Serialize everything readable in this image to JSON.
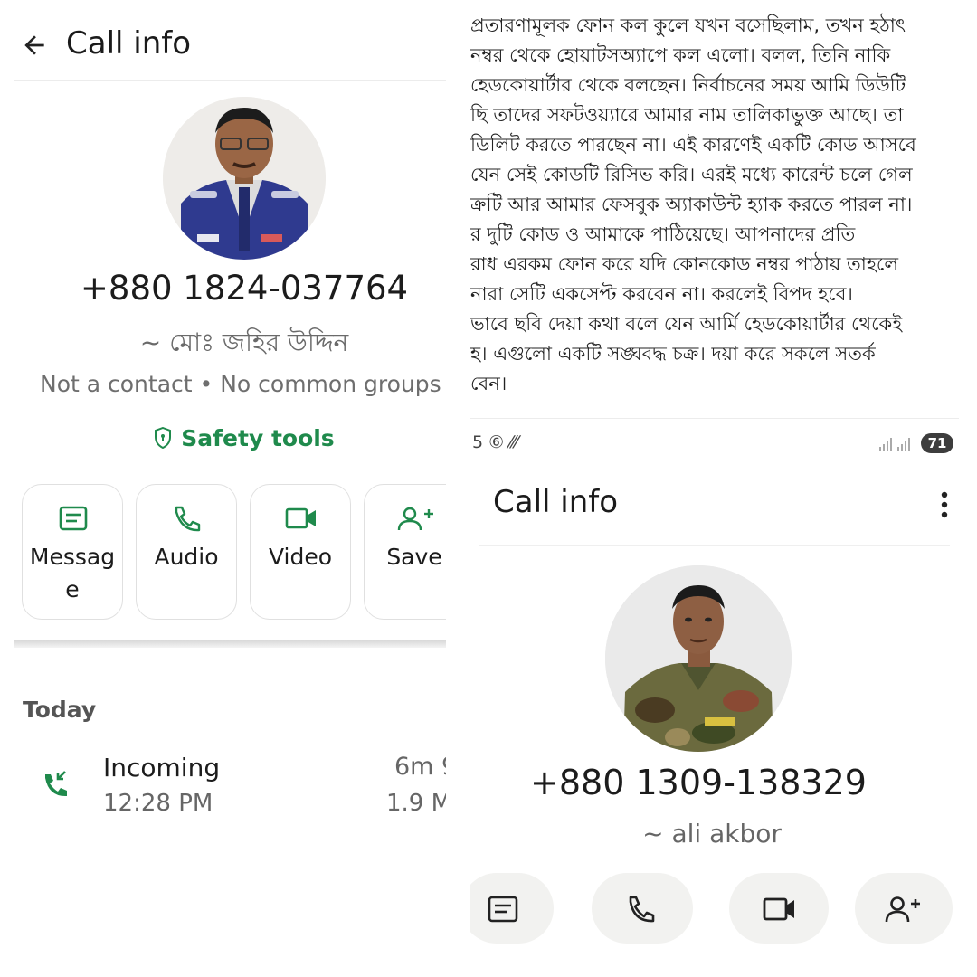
{
  "left": {
    "title": "Call info",
    "phone": "+880 1824-037764",
    "alias": "~ মোঃ জহির উদ্দিন",
    "meta": "Not a contact • No common groups",
    "safety_tools": "Safety tools",
    "actions": [
      {
        "label": "Message",
        "icon": "message-icon"
      },
      {
        "label": "Audio",
        "icon": "phone-icon"
      },
      {
        "label": "Video",
        "icon": "video-icon"
      },
      {
        "label": "Save",
        "icon": "add-contact-icon"
      }
    ],
    "history": {
      "heading": "Today",
      "calls": [
        {
          "type": "Incoming",
          "time": "12:28 PM",
          "duration": "6m 9",
          "size": "1.9 M"
        }
      ]
    }
  },
  "right": {
    "post_lines": [
      "প্রতারণামূলক ফোন কল কুলে যখন বসেছিলাম, তখন হঠাৎ",
      "নম্বর থেকে হোয়াটসঅ্যাপে কল এলো। বলল, তিনি নাকি",
      "হেডকোয়ার্টার থেকে বলছেন। নির্বাচনের সময় আমি ডিউটি",
      "ছি তাদের সফটওয়্যারে আমার নাম তালিকাভুক্ত আছে। তা",
      "ডিলিট করতে পারছেন না। এই কারণেই একটি কোড আসবে",
      "যেন সেই কোডটি রিসিভ করি। এরই মধ্যে কারেন্ট চলে গেল",
      "ক্রটি আর আমার ফেসবুক অ্যাকাউন্ট হ্যাক করতে পারল না।",
      "র দুটি কোড ও আমাকে পাঠিয়েছে। আপনাদের প্রতি",
      "রাধ এরকম ফোন করে যদি কোনকোড নম্বর পাঠায় তাহলে",
      "নারা সেটি একসেপ্ট করবেন না। করলেই বিপদ হবে।",
      "ভাবে ছবি দেয়া কথা বলে যেন আর্মি হেডকোয়ার্টার থেকেই",
      "হ। এগুলো একটি সঙ্ঘবদ্ধ চক্র। দয়া করে সকলে সতর্ক",
      "বেন।"
    ],
    "status_left": "5 ⑥ ⁄⁄⁄",
    "battery": "71",
    "title": "Call info",
    "phone": "+880 1309-138329",
    "alias": "~ ali akbor",
    "actions": [
      "message-icon",
      "phone-icon",
      "video-icon",
      "add-contact-icon"
    ]
  },
  "colors": {
    "accent_green": "#1f8a4c",
    "text_primary": "#1b1b1b",
    "text_secondary": "#6e6e6e"
  }
}
